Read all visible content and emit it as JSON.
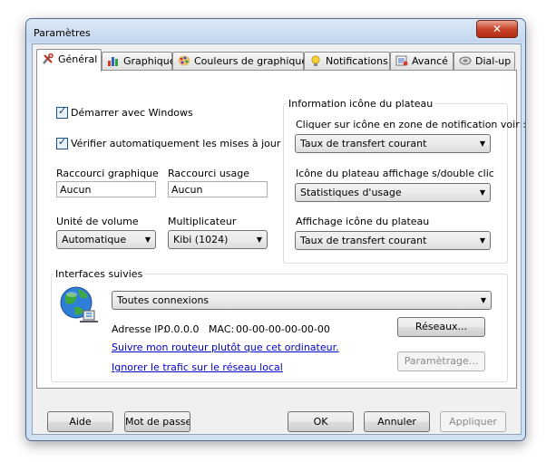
{
  "window": {
    "title": "Paramètres",
    "close_glyph": "✕"
  },
  "tabs": [
    {
      "label": "Général",
      "icon": "tools-icon"
    },
    {
      "label": "Graphique",
      "icon": "bar-chart-icon"
    },
    {
      "label": "Couleurs de graphique",
      "icon": "palette-icon"
    },
    {
      "label": "Notifications",
      "icon": "bulb-icon"
    },
    {
      "label": "Avancé",
      "icon": "advanced-icon"
    },
    {
      "label": "Dial-up",
      "icon": "dialup-icon"
    }
  ],
  "general": {
    "start_windows": {
      "label": "Démarrer avec Windows",
      "checked": true
    },
    "check_updates": {
      "label": "Vérifier automatiquement les mises à jour",
      "checked": true
    },
    "shortcut_graph": {
      "label": "Raccourci graphique",
      "value": "Aucun"
    },
    "shortcut_usage": {
      "label": "Raccourci usage",
      "value": "Aucun"
    },
    "volume_unit": {
      "label": "Unité de volume",
      "value": "Automatique"
    },
    "multiplier": {
      "label": "Multiplicateur",
      "value": "Kibi (1024)"
    }
  },
  "tray": {
    "group_title": "Information icône du plateau",
    "click_label": "Cliquer sur icône en zone de notification voir :",
    "click_value": "Taux de transfert courant",
    "dblclick_label": "Icône du plateau affichage s/double clic",
    "dblclick_value": "Statistiques d'usage",
    "display_label": "Affichage icône du plateau",
    "display_value": "Taux de transfert courant"
  },
  "interfaces": {
    "group_title": "Interfaces suivies",
    "selected": "Toutes connexions",
    "ip_label": "Adresse IP:",
    "ip_value": "0.0.0.0",
    "mac_label": "MAC:",
    "mac_value": "00-00-00-00-00-00",
    "follow_router_link": "Suivre mon routeur plutôt que cet ordinateur.",
    "ignore_local_link": "Ignorer le trafic sur le réseau local",
    "networks_button": "Réseaux...",
    "settings_button": "Paramètrage..."
  },
  "footer": {
    "help_button": "Aide",
    "password_button": "Mot de passe...",
    "ok_button": "OK",
    "cancel_button": "Annuler",
    "apply_button": "Appliquer"
  }
}
